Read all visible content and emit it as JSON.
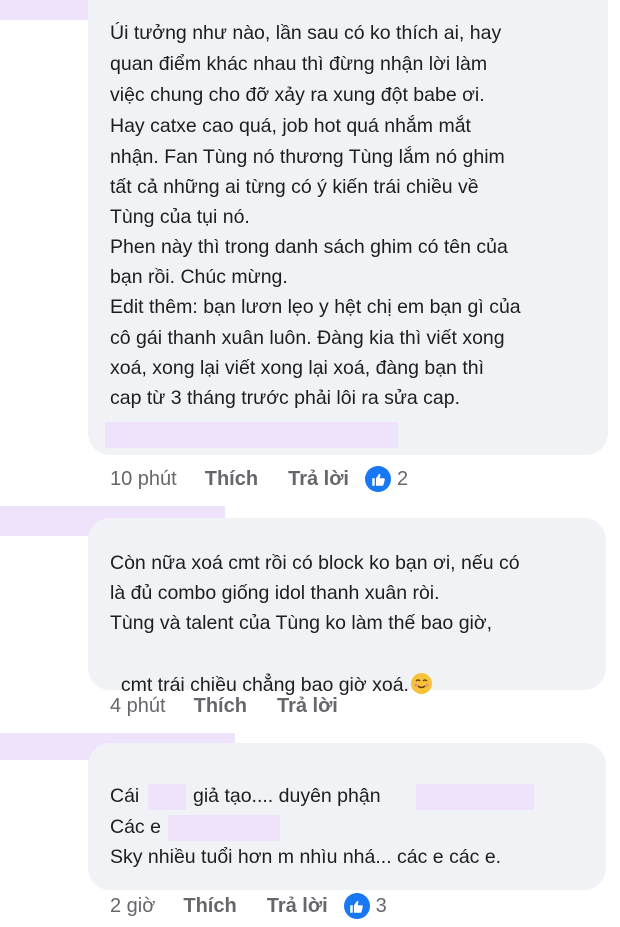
{
  "comments": [
    {
      "lines": [
        "Úi tưởng như nào, lần sau có ko thích ai, hay",
        "quan điểm khác nhau thì đừng nhận lời làm",
        "việc chung cho đỡ xảy ra xung đột babe ơi.",
        "Hay catxe cao quá, job hot quá nhắm mắt",
        "nhận. Fan Tùng nó thương Tùng lắm nó ghim",
        "tất cả những ai từng có ý kiến trái chiều về",
        "Tùng của tụi nó.",
        "Phen này thì trong danh sách ghim có tên của",
        "bạn rồi. Chúc mừng.",
        "Edit thêm: bạn lươn lẹo y hệt chị em bạn gì của",
        "cô gái thanh xuân luôn. Đàng kia thì viết xong",
        "xoá, xong lại viết xong lại xoá, đàng bạn thì",
        "cap từ 3 tháng trước phải lôi ra sửa cap."
      ],
      "time": "10 phút",
      "like_label": "Thích",
      "reply_label": "Trả lời",
      "reaction_count": "2"
    },
    {
      "lines": [
        "Còn nữa xoá cmt rồi có block ko bạn ơi, nếu có",
        "là đủ combo giống idol thanh xuân ròi.",
        "Tùng và talent của Tùng ko làm thế bao giờ,",
        "cmt trái chiều chẳng bao giờ xoá."
      ],
      "time": "4 phút",
      "like_label": "Thích",
      "reply_label": "Trả lời"
    },
    {
      "lines": [
        "Cái",
        "giả tạo.... duyên phận",
        "Các e",
        "Sky nhiều tuổi hơn m nhìu nhá... các e các e."
      ],
      "time": "2 giờ",
      "like_label": "Thích",
      "reply_label": "Trả lời",
      "reaction_count": "3"
    }
  ],
  "colors": {
    "bubble": "#f0f2f5",
    "redaction": "#efe3fb",
    "like_blue": "#1877f2",
    "meta_gray": "#65676b"
  },
  "icons": [
    "like-icon",
    "smiling-face-emoji-icon"
  ]
}
